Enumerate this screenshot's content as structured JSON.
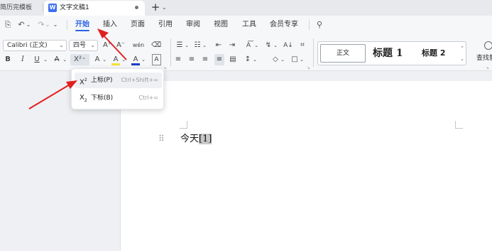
{
  "tabs": {
    "previous": "简历完模板",
    "active": "文字文稿1",
    "new_tab": "+",
    "more": "⌄"
  },
  "quick_access": {
    "save": "⎘",
    "undo": "↶",
    "undo_more": "⌄",
    "redo": "↷",
    "redo_more": "⌄",
    "more": "⌄"
  },
  "menu": {
    "items": [
      "开始",
      "插入",
      "页面",
      "引用",
      "审阅",
      "视图",
      "工具",
      "会员专享"
    ],
    "active": "开始",
    "search": "⚲"
  },
  "ribbon": {
    "font_name": "Calibri (正文)",
    "font_size": "四号",
    "grow_font": "A⁺",
    "shrink_font": "A⁻",
    "phonetic": "wén",
    "clear_format": "⌫",
    "bold": "B",
    "italic": "I",
    "underline": "U",
    "strikethrough": "A",
    "superscript": "X²",
    "highlight": "A",
    "highlight_color": "#f2e03a",
    "font_color": "A",
    "font_color_value": "#1a3cc8",
    "char_border": "A",
    "bullets": "☰",
    "numbering": "☷",
    "align_left": "≡",
    "align_center": "≡",
    "align_right": "≡",
    "justify": "≡",
    "distribute": "▤",
    "line_spacing": "↕",
    "shading": "◇",
    "borders": "□",
    "styles": {
      "normal": "正文",
      "heading1": "标题 1",
      "heading2": "标题 2"
    },
    "find": "查找替换"
  },
  "dropdown": {
    "items": [
      {
        "icon_base": "X",
        "icon_mark": "2",
        "label": "上标(P)",
        "shortcut": "Ctrl+Shift+="
      },
      {
        "icon_base": "X",
        "icon_mark": "2",
        "label": "下标(B)",
        "shortcut": "Ctrl+="
      }
    ]
  },
  "document": {
    "text": "今天",
    "selected": "[1]",
    "drag_handle": "⠿"
  },
  "colors": {
    "accent": "#2a62e6",
    "arrow": "#e02020",
    "doc_logo": "#3f6ff0"
  }
}
